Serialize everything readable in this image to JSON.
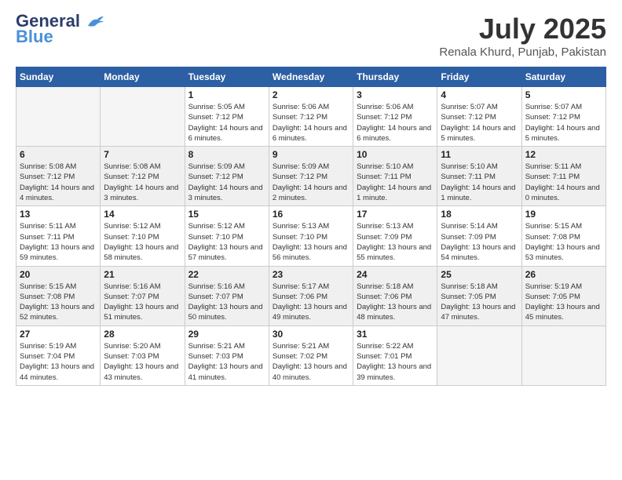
{
  "header": {
    "logo_general": "General",
    "logo_blue": "Blue",
    "month_title": "July 2025",
    "location": "Renala Khurd, Punjab, Pakistan"
  },
  "days_of_week": [
    "Sunday",
    "Monday",
    "Tuesday",
    "Wednesday",
    "Thursday",
    "Friday",
    "Saturday"
  ],
  "weeks": [
    [
      {
        "day": "",
        "sunrise": "",
        "sunset": "",
        "daylight": ""
      },
      {
        "day": "",
        "sunrise": "",
        "sunset": "",
        "daylight": ""
      },
      {
        "day": "1",
        "sunrise": "Sunrise: 5:05 AM",
        "sunset": "Sunset: 7:12 PM",
        "daylight": "Daylight: 14 hours and 6 minutes."
      },
      {
        "day": "2",
        "sunrise": "Sunrise: 5:06 AM",
        "sunset": "Sunset: 7:12 PM",
        "daylight": "Daylight: 14 hours and 6 minutes."
      },
      {
        "day": "3",
        "sunrise": "Sunrise: 5:06 AM",
        "sunset": "Sunset: 7:12 PM",
        "daylight": "Daylight: 14 hours and 6 minutes."
      },
      {
        "day": "4",
        "sunrise": "Sunrise: 5:07 AM",
        "sunset": "Sunset: 7:12 PM",
        "daylight": "Daylight: 14 hours and 5 minutes."
      },
      {
        "day": "5",
        "sunrise": "Sunrise: 5:07 AM",
        "sunset": "Sunset: 7:12 PM",
        "daylight": "Daylight: 14 hours and 5 minutes."
      }
    ],
    [
      {
        "day": "6",
        "sunrise": "Sunrise: 5:08 AM",
        "sunset": "Sunset: 7:12 PM",
        "daylight": "Daylight: 14 hours and 4 minutes."
      },
      {
        "day": "7",
        "sunrise": "Sunrise: 5:08 AM",
        "sunset": "Sunset: 7:12 PM",
        "daylight": "Daylight: 14 hours and 3 minutes."
      },
      {
        "day": "8",
        "sunrise": "Sunrise: 5:09 AM",
        "sunset": "Sunset: 7:12 PM",
        "daylight": "Daylight: 14 hours and 3 minutes."
      },
      {
        "day": "9",
        "sunrise": "Sunrise: 5:09 AM",
        "sunset": "Sunset: 7:12 PM",
        "daylight": "Daylight: 14 hours and 2 minutes."
      },
      {
        "day": "10",
        "sunrise": "Sunrise: 5:10 AM",
        "sunset": "Sunset: 7:11 PM",
        "daylight": "Daylight: 14 hours and 1 minute."
      },
      {
        "day": "11",
        "sunrise": "Sunrise: 5:10 AM",
        "sunset": "Sunset: 7:11 PM",
        "daylight": "Daylight: 14 hours and 1 minute."
      },
      {
        "day": "12",
        "sunrise": "Sunrise: 5:11 AM",
        "sunset": "Sunset: 7:11 PM",
        "daylight": "Daylight: 14 hours and 0 minutes."
      }
    ],
    [
      {
        "day": "13",
        "sunrise": "Sunrise: 5:11 AM",
        "sunset": "Sunset: 7:11 PM",
        "daylight": "Daylight: 13 hours and 59 minutes."
      },
      {
        "day": "14",
        "sunrise": "Sunrise: 5:12 AM",
        "sunset": "Sunset: 7:10 PM",
        "daylight": "Daylight: 13 hours and 58 minutes."
      },
      {
        "day": "15",
        "sunrise": "Sunrise: 5:12 AM",
        "sunset": "Sunset: 7:10 PM",
        "daylight": "Daylight: 13 hours and 57 minutes."
      },
      {
        "day": "16",
        "sunrise": "Sunrise: 5:13 AM",
        "sunset": "Sunset: 7:10 PM",
        "daylight": "Daylight: 13 hours and 56 minutes."
      },
      {
        "day": "17",
        "sunrise": "Sunrise: 5:13 AM",
        "sunset": "Sunset: 7:09 PM",
        "daylight": "Daylight: 13 hours and 55 minutes."
      },
      {
        "day": "18",
        "sunrise": "Sunrise: 5:14 AM",
        "sunset": "Sunset: 7:09 PM",
        "daylight": "Daylight: 13 hours and 54 minutes."
      },
      {
        "day": "19",
        "sunrise": "Sunrise: 5:15 AM",
        "sunset": "Sunset: 7:08 PM",
        "daylight": "Daylight: 13 hours and 53 minutes."
      }
    ],
    [
      {
        "day": "20",
        "sunrise": "Sunrise: 5:15 AM",
        "sunset": "Sunset: 7:08 PM",
        "daylight": "Daylight: 13 hours and 52 minutes."
      },
      {
        "day": "21",
        "sunrise": "Sunrise: 5:16 AM",
        "sunset": "Sunset: 7:07 PM",
        "daylight": "Daylight: 13 hours and 51 minutes."
      },
      {
        "day": "22",
        "sunrise": "Sunrise: 5:16 AM",
        "sunset": "Sunset: 7:07 PM",
        "daylight": "Daylight: 13 hours and 50 minutes."
      },
      {
        "day": "23",
        "sunrise": "Sunrise: 5:17 AM",
        "sunset": "Sunset: 7:06 PM",
        "daylight": "Daylight: 13 hours and 49 minutes."
      },
      {
        "day": "24",
        "sunrise": "Sunrise: 5:18 AM",
        "sunset": "Sunset: 7:06 PM",
        "daylight": "Daylight: 13 hours and 48 minutes."
      },
      {
        "day": "25",
        "sunrise": "Sunrise: 5:18 AM",
        "sunset": "Sunset: 7:05 PM",
        "daylight": "Daylight: 13 hours and 47 minutes."
      },
      {
        "day": "26",
        "sunrise": "Sunrise: 5:19 AM",
        "sunset": "Sunset: 7:05 PM",
        "daylight": "Daylight: 13 hours and 45 minutes."
      }
    ],
    [
      {
        "day": "27",
        "sunrise": "Sunrise: 5:19 AM",
        "sunset": "Sunset: 7:04 PM",
        "daylight": "Daylight: 13 hours and 44 minutes."
      },
      {
        "day": "28",
        "sunrise": "Sunrise: 5:20 AM",
        "sunset": "Sunset: 7:03 PM",
        "daylight": "Daylight: 13 hours and 43 minutes."
      },
      {
        "day": "29",
        "sunrise": "Sunrise: 5:21 AM",
        "sunset": "Sunset: 7:03 PM",
        "daylight": "Daylight: 13 hours and 41 minutes."
      },
      {
        "day": "30",
        "sunrise": "Sunrise: 5:21 AM",
        "sunset": "Sunset: 7:02 PM",
        "daylight": "Daylight: 13 hours and 40 minutes."
      },
      {
        "day": "31",
        "sunrise": "Sunrise: 5:22 AM",
        "sunset": "Sunset: 7:01 PM",
        "daylight": "Daylight: 13 hours and 39 minutes."
      },
      {
        "day": "",
        "sunrise": "",
        "sunset": "",
        "daylight": ""
      },
      {
        "day": "",
        "sunrise": "",
        "sunset": "",
        "daylight": ""
      }
    ]
  ]
}
